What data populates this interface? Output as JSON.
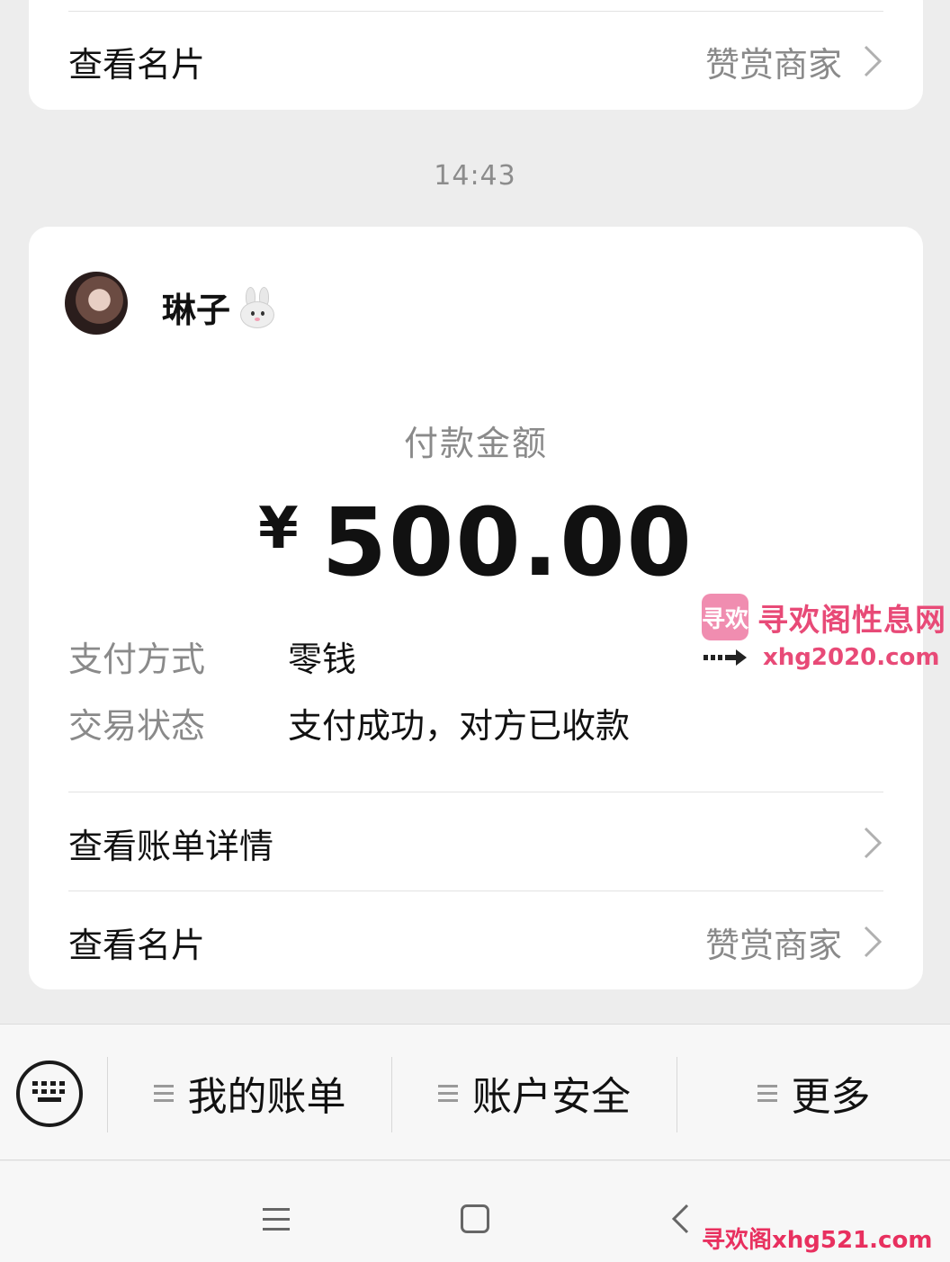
{
  "top_card": {
    "view_card_label": "查看名片",
    "reward_merchant_label": "赞赏商家"
  },
  "timestamp": "14:43",
  "payment_card": {
    "username": "琳子",
    "payment_amount_label": "付款金额",
    "currency_symbol": "¥",
    "amount": "500.00",
    "info": [
      {
        "key": "支付方式",
        "value": "零钱"
      },
      {
        "key": "交易状态",
        "value": "支付成功，对方已收款"
      }
    ],
    "view_bill_details_label": "查看账单详情",
    "view_card_label": "查看名片",
    "reward_merchant_label": "赞赏商家"
  },
  "menu": {
    "items": [
      {
        "label": "我的账单"
      },
      {
        "label": "账户安全"
      },
      {
        "label": "更多"
      }
    ]
  },
  "watermark": {
    "logo_text": "寻欢",
    "title": "寻欢阁性息网",
    "url": "xhg2020.com",
    "bottom": "寻欢阁xhg521.com"
  },
  "icons": {
    "keyboard": "keyboard-icon",
    "chevron": "chevron-right-icon",
    "bunny": "bunny-emoji-icon",
    "nav_menu": "nav-menu-icon",
    "nav_home": "nav-home-icon",
    "nav_back": "nav-back-icon"
  },
  "colors": {
    "background": "#ededed",
    "card": "#ffffff",
    "secondary_text": "#8a8a8a",
    "watermark": "#e84a77"
  }
}
